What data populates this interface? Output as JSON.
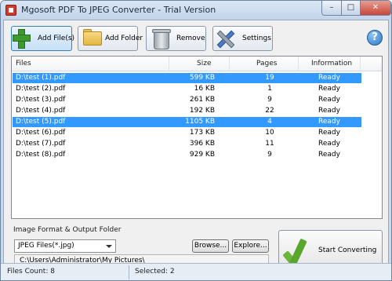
{
  "window": {
    "title": "Mgosoft PDF To JPEG Converter - Trial Version"
  },
  "toolbar": {
    "add_files": "Add File(s)",
    "add_folder": "Add Folder",
    "remove": "Remove",
    "settings": "Settings",
    "help": "?"
  },
  "list": {
    "columns": [
      "Files",
      "Size",
      "Pages",
      "Information"
    ],
    "rows": [
      {
        "file": "D:\\test (1).pdf",
        "size": "599 KB",
        "pages": "19",
        "info": "Ready",
        "selected": true
      },
      {
        "file": "D:\\test (2).pdf",
        "size": "16 KB",
        "pages": "1",
        "info": "Ready",
        "selected": false
      },
      {
        "file": "D:\\test (3).pdf",
        "size": "261 KB",
        "pages": "9",
        "info": "Ready",
        "selected": false
      },
      {
        "file": "D:\\test (4).pdf",
        "size": "192 KB",
        "pages": "22",
        "info": "Ready",
        "selected": false
      },
      {
        "file": "D:\\test (5).pdf",
        "size": "1105 KB",
        "pages": "4",
        "info": "Ready",
        "selected": true
      },
      {
        "file": "D:\\test (6).pdf",
        "size": "173 KB",
        "pages": "10",
        "info": "Ready",
        "selected": false
      },
      {
        "file": "D:\\test (7).pdf",
        "size": "396 KB",
        "pages": "11",
        "info": "Ready",
        "selected": false
      },
      {
        "file": "D:\\test (8).pdf",
        "size": "929 KB",
        "pages": "9",
        "info": "Ready",
        "selected": false
      }
    ]
  },
  "output": {
    "group_label": "Image Format & Output Folder",
    "format_value": "JPEG Files(*.jpg)",
    "browse": "Browse...",
    "explore": "Explore...",
    "path": "C:\\Users\\Administrator\\My Pictures\\"
  },
  "start": {
    "label": "Start Converting"
  },
  "status": {
    "files_count": "Files Count: 8",
    "selected": "Selected: 2"
  },
  "colors": {
    "selection": "#3399ff",
    "accent": "#3c7fb1"
  }
}
